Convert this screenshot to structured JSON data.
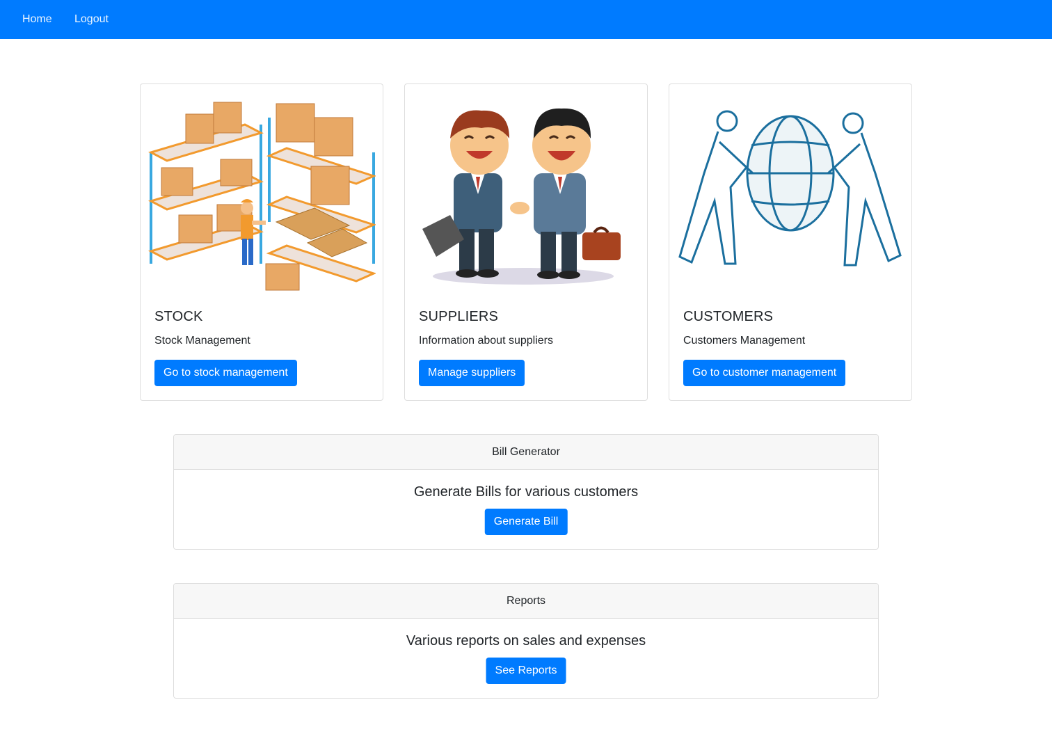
{
  "nav": {
    "home": "Home",
    "logout": "Logout"
  },
  "cards": [
    {
      "title": "STOCK",
      "text": "Stock Management",
      "button": "Go to stock management",
      "image": "warehouse-shelves-illustration"
    },
    {
      "title": "SUPPLIERS",
      "text": "Information about suppliers",
      "button": "Manage suppliers",
      "image": "business-handshake-illustration"
    },
    {
      "title": "CUSTOMERS",
      "text": "Customers Management",
      "button": "Go to customer management",
      "image": "people-holding-customer-globe-illustration"
    }
  ],
  "bill": {
    "header": "Bill Generator",
    "title": "Generate Bills for various customers",
    "button": "Generate Bill"
  },
  "reports": {
    "header": "Reports",
    "title": "Various reports on sales and expenses",
    "button": "See Reports"
  },
  "colors": {
    "primary": "#007bff",
    "panel_header_bg": "#f7f7f7",
    "text": "#212529"
  }
}
